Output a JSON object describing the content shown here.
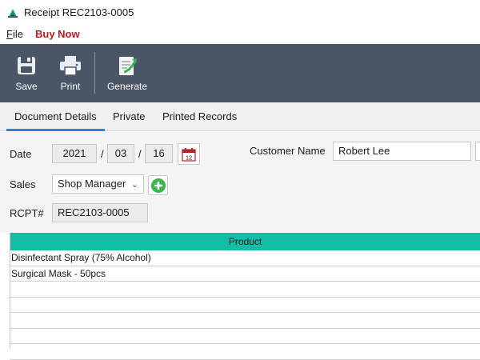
{
  "window": {
    "title": "Receipt REC2103-0005"
  },
  "menu": {
    "file_prefix": "F",
    "file_rest": "ile",
    "buy_now": "Buy Now"
  },
  "toolbar": {
    "save": "Save",
    "print": "Print",
    "generate": "Generate"
  },
  "tabs": [
    "Document Details",
    "Private",
    "Printed Records"
  ],
  "form": {
    "date_label": "Date",
    "date_year": "2021",
    "date_month": "03",
    "date_day": "16",
    "date_sep": "/",
    "calendar_icon_text": "12",
    "customer_label": "Customer Name",
    "customer_value": "Robert Lee",
    "sales_label": "Sales",
    "sales_value": "Shop Manager",
    "rcpt_label": "RCPT#",
    "rcpt_value": "REC2103-0005"
  },
  "grid": {
    "header": "Product",
    "rows": [
      "Disinfectant Spray (75% Alcohol)",
      "Surgical Mask - 50pcs",
      "",
      "",
      "",
      "",
      ""
    ]
  },
  "colors": {
    "toolbar_bg": "#4a5566",
    "grid_header": "#12bfa6",
    "buy_now": "#c0191f",
    "tab_accent": "#3a7bd5"
  }
}
